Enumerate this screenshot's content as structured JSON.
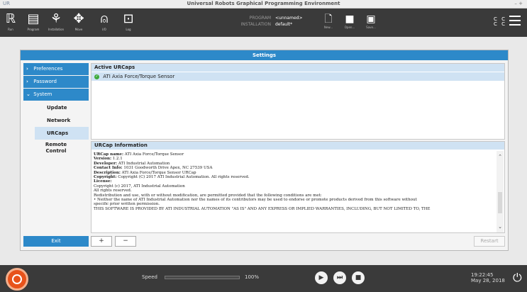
{
  "window": {
    "title": "Universal Robots Graphical Programming Environment",
    "controls": "– +"
  },
  "toolbar": {
    "tools": [
      {
        "label": "Run"
      },
      {
        "label": "Program"
      },
      {
        "label": "Installation"
      },
      {
        "label": "Move"
      },
      {
        "label": "I/O"
      },
      {
        "label": "Log"
      }
    ],
    "program_key": "PROGRAM",
    "program_value": "<unnamed>",
    "installation_key": "INSTALLATION",
    "installation_value": "default*",
    "file_buttons": [
      {
        "label": "New..."
      },
      {
        "label": "Open..."
      },
      {
        "label": "Save..."
      }
    ],
    "cc_top": "C C",
    "cc_bottom": "C C"
  },
  "settings": {
    "title": "Settings",
    "sidebar": [
      {
        "label": "Preferences",
        "expanded": false
      },
      {
        "label": "Password",
        "expanded": false
      },
      {
        "label": "System",
        "expanded": true
      }
    ],
    "system_items": [
      "Update",
      "Network",
      "URCaps",
      "Remote Control"
    ],
    "selected_item": "URCaps",
    "exit_label": "Exit",
    "active_urcaps_header": "Active URCaps",
    "urcaps": [
      "ATI Axia Force/Torque Sensor"
    ],
    "info_header": "URCap Information",
    "info": {
      "name_label": "URCap name:",
      "name": "ATI Axia Force/Torque Sensor",
      "version_label": "Version:",
      "version": "1.2.1",
      "developer_label": "Developer:",
      "developer": "ATI Industrial Automation",
      "contact_label": "Contact Info:",
      "contact": "1031 Goodworth Drive Apex, NC 27539 USA",
      "description_label": "Description:",
      "description": "ATI Axia Force/Torque Sensor URCap",
      "copyright_label": "Copyright:",
      "copyright": "Copyright (C) 2017 ATI Industrial Automation. All rights reserved.",
      "license_label": "License:",
      "license_line1": "Copyright (c) 2017, ATI Industrial Automation",
      "license_line2": "All rights reserved.",
      "license_line3": "Redistribution and use, with or without modification, are permitted provided that the following conditions are met:",
      "license_line4": "• Neither the name of ATI Industrial Automation nor the names of its contributors may be used to endorse or promote products derived from this software without",
      "license_line5": "specific prior written permission.",
      "license_line6": "THIS SOFTWARE IS PROVIDED BY ATI INDUSTRIAL AUTOMATION \"AS IS\" AND ANY EXPRESS OR IMPLIED WARRANTIES, INCLUDING, BUT NOT LIMITED TO, THE"
    },
    "plus_label": "+",
    "minus_label": "−",
    "restart_label": "Restart"
  },
  "footer": {
    "speed_label": "Speed",
    "speed_value": "100%",
    "speed_fraction": 1.0,
    "time": "19:22:45",
    "date": "May 28, 2018"
  },
  "colors": {
    "accent": "#2d89c9",
    "selected": "#cfe2f3",
    "header_bg": "#3a3a3a",
    "power": "#e8521a",
    "check": "#3daa3a"
  }
}
